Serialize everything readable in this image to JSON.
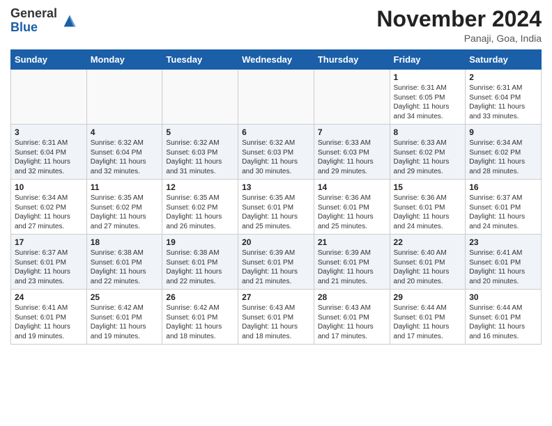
{
  "header": {
    "logo_general": "General",
    "logo_blue": "Blue",
    "month_title": "November 2024",
    "location": "Panaji, Goa, India"
  },
  "weekdays": [
    "Sunday",
    "Monday",
    "Tuesday",
    "Wednesday",
    "Thursday",
    "Friday",
    "Saturday"
  ],
  "weeks": [
    [
      {
        "day": "",
        "info": ""
      },
      {
        "day": "",
        "info": ""
      },
      {
        "day": "",
        "info": ""
      },
      {
        "day": "",
        "info": ""
      },
      {
        "day": "",
        "info": ""
      },
      {
        "day": "1",
        "info": "Sunrise: 6:31 AM\nSunset: 6:05 PM\nDaylight: 11 hours\nand 34 minutes."
      },
      {
        "day": "2",
        "info": "Sunrise: 6:31 AM\nSunset: 6:04 PM\nDaylight: 11 hours\nand 33 minutes."
      }
    ],
    [
      {
        "day": "3",
        "info": "Sunrise: 6:31 AM\nSunset: 6:04 PM\nDaylight: 11 hours\nand 32 minutes."
      },
      {
        "day": "4",
        "info": "Sunrise: 6:32 AM\nSunset: 6:04 PM\nDaylight: 11 hours\nand 32 minutes."
      },
      {
        "day": "5",
        "info": "Sunrise: 6:32 AM\nSunset: 6:03 PM\nDaylight: 11 hours\nand 31 minutes."
      },
      {
        "day": "6",
        "info": "Sunrise: 6:32 AM\nSunset: 6:03 PM\nDaylight: 11 hours\nand 30 minutes."
      },
      {
        "day": "7",
        "info": "Sunrise: 6:33 AM\nSunset: 6:03 PM\nDaylight: 11 hours\nand 29 minutes."
      },
      {
        "day": "8",
        "info": "Sunrise: 6:33 AM\nSunset: 6:02 PM\nDaylight: 11 hours\nand 29 minutes."
      },
      {
        "day": "9",
        "info": "Sunrise: 6:34 AM\nSunset: 6:02 PM\nDaylight: 11 hours\nand 28 minutes."
      }
    ],
    [
      {
        "day": "10",
        "info": "Sunrise: 6:34 AM\nSunset: 6:02 PM\nDaylight: 11 hours\nand 27 minutes."
      },
      {
        "day": "11",
        "info": "Sunrise: 6:35 AM\nSunset: 6:02 PM\nDaylight: 11 hours\nand 27 minutes."
      },
      {
        "day": "12",
        "info": "Sunrise: 6:35 AM\nSunset: 6:02 PM\nDaylight: 11 hours\nand 26 minutes."
      },
      {
        "day": "13",
        "info": "Sunrise: 6:35 AM\nSunset: 6:01 PM\nDaylight: 11 hours\nand 25 minutes."
      },
      {
        "day": "14",
        "info": "Sunrise: 6:36 AM\nSunset: 6:01 PM\nDaylight: 11 hours\nand 25 minutes."
      },
      {
        "day": "15",
        "info": "Sunrise: 6:36 AM\nSunset: 6:01 PM\nDaylight: 11 hours\nand 24 minutes."
      },
      {
        "day": "16",
        "info": "Sunrise: 6:37 AM\nSunset: 6:01 PM\nDaylight: 11 hours\nand 24 minutes."
      }
    ],
    [
      {
        "day": "17",
        "info": "Sunrise: 6:37 AM\nSunset: 6:01 PM\nDaylight: 11 hours\nand 23 minutes."
      },
      {
        "day": "18",
        "info": "Sunrise: 6:38 AM\nSunset: 6:01 PM\nDaylight: 11 hours\nand 22 minutes."
      },
      {
        "day": "19",
        "info": "Sunrise: 6:38 AM\nSunset: 6:01 PM\nDaylight: 11 hours\nand 22 minutes."
      },
      {
        "day": "20",
        "info": "Sunrise: 6:39 AM\nSunset: 6:01 PM\nDaylight: 11 hours\nand 21 minutes."
      },
      {
        "day": "21",
        "info": "Sunrise: 6:39 AM\nSunset: 6:01 PM\nDaylight: 11 hours\nand 21 minutes."
      },
      {
        "day": "22",
        "info": "Sunrise: 6:40 AM\nSunset: 6:01 PM\nDaylight: 11 hours\nand 20 minutes."
      },
      {
        "day": "23",
        "info": "Sunrise: 6:41 AM\nSunset: 6:01 PM\nDaylight: 11 hours\nand 20 minutes."
      }
    ],
    [
      {
        "day": "24",
        "info": "Sunrise: 6:41 AM\nSunset: 6:01 PM\nDaylight: 11 hours\nand 19 minutes."
      },
      {
        "day": "25",
        "info": "Sunrise: 6:42 AM\nSunset: 6:01 PM\nDaylight: 11 hours\nand 19 minutes."
      },
      {
        "day": "26",
        "info": "Sunrise: 6:42 AM\nSunset: 6:01 PM\nDaylight: 11 hours\nand 18 minutes."
      },
      {
        "day": "27",
        "info": "Sunrise: 6:43 AM\nSunset: 6:01 PM\nDaylight: 11 hours\nand 18 minutes."
      },
      {
        "day": "28",
        "info": "Sunrise: 6:43 AM\nSunset: 6:01 PM\nDaylight: 11 hours\nand 17 minutes."
      },
      {
        "day": "29",
        "info": "Sunrise: 6:44 AM\nSunset: 6:01 PM\nDaylight: 11 hours\nand 17 minutes."
      },
      {
        "day": "30",
        "info": "Sunrise: 6:44 AM\nSunset: 6:01 PM\nDaylight: 11 hours\nand 16 minutes."
      }
    ]
  ]
}
